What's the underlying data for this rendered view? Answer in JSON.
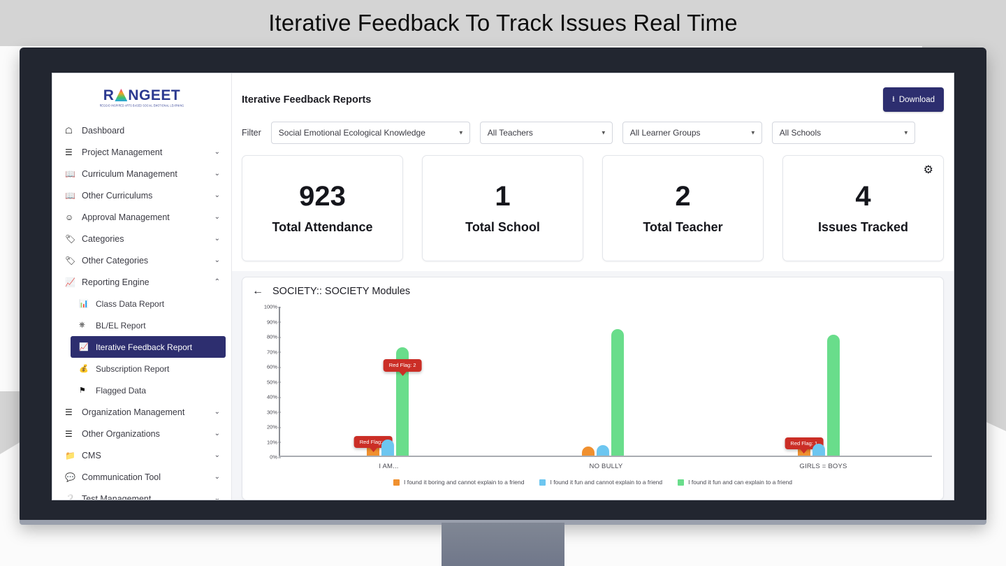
{
  "slide": {
    "title": "Iterative Feedback To Track Issues Real Time"
  },
  "brand": {
    "name": "RANGEET",
    "tagline": "REGGIO INSPIRED ARTS BASED SOCIAL EMOTIONAL LEARNING"
  },
  "sidebar": {
    "items": [
      {
        "label": "Dashboard",
        "icon": "home-icon",
        "chevron": ""
      },
      {
        "label": "Project Management",
        "icon": "server-icon",
        "chevron": "⌄"
      },
      {
        "label": "Curriculum Management",
        "icon": "book-icon",
        "chevron": "⌄"
      },
      {
        "label": "Other Curriculums",
        "icon": "book-icon",
        "chevron": "⌄"
      },
      {
        "label": "Approval Management",
        "icon": "user-check-icon",
        "chevron": "⌄"
      },
      {
        "label": "Categories",
        "icon": "tag-icon",
        "chevron": "⌄"
      },
      {
        "label": "Other Categories",
        "icon": "tag-icon",
        "chevron": "⌄"
      },
      {
        "label": "Reporting Engine",
        "icon": "chart-line-icon",
        "chevron": "⌃"
      }
    ],
    "sub_items": [
      {
        "label": "Class Data Report",
        "icon": "bar-chart-icon"
      },
      {
        "label": "BL/EL Report",
        "icon": "sitemap-icon"
      },
      {
        "label": "Iterative Feedback Report",
        "icon": "chart-area-icon"
      },
      {
        "label": "Subscription Report",
        "icon": "money-bag-icon"
      },
      {
        "label": "Flagged Data",
        "icon": "flag-icon"
      }
    ],
    "items_after": [
      {
        "label": "Organization Management",
        "icon": "server-icon",
        "chevron": "⌄"
      },
      {
        "label": "Other Organizations",
        "icon": "server-icon",
        "chevron": "⌄"
      },
      {
        "label": "CMS",
        "icon": "folder-icon",
        "chevron": "⌄"
      },
      {
        "label": "Communication Tool",
        "icon": "comment-icon",
        "chevron": "⌄"
      },
      {
        "label": "Test Management",
        "icon": "help-circle-icon",
        "chevron": "⌄"
      }
    ],
    "active_label": "Iterative Feedback Report",
    "active_color": "#2d2e6f"
  },
  "header": {
    "title": "Iterative Feedback Reports",
    "download_label": "Download",
    "download_icon": "download-icon",
    "download_color": "#2d2e6f"
  },
  "filter": {
    "label": "Filter",
    "selects": [
      {
        "name": "curriculum",
        "value": "Social Emotional Ecological Knowledge"
      },
      {
        "name": "teachers",
        "value": "All Teachers"
      },
      {
        "name": "learner-groups",
        "value": "All Learner Groups"
      },
      {
        "name": "schools",
        "value": "All Schools"
      }
    ]
  },
  "stats": [
    {
      "value": "923",
      "label": "Total Attendance"
    },
    {
      "value": "1",
      "label": "Total School"
    },
    {
      "value": "2",
      "label": "Total Teacher"
    },
    {
      "value": "4",
      "label": "Issues Tracked",
      "gear_icon": "gear-icon"
    }
  ],
  "chart_panel": {
    "back_icon": "arrow-left-icon",
    "title": "SOCIETY:: SOCIETY Modules"
  },
  "chart_data": {
    "type": "bar",
    "title": "SOCIETY:: SOCIETY Modules",
    "xlabel": "",
    "ylabel": "",
    "ylim": [
      0,
      100
    ],
    "yticks": [
      "0%",
      "10%",
      "20%",
      "30%",
      "40%",
      "50%",
      "60%",
      "70%",
      "80%",
      "90%",
      "100%"
    ],
    "grid": false,
    "legend_position": "bottom",
    "categories": [
      "I AM...",
      "NO BULLY",
      "GIRLS = BOYS"
    ],
    "series": [
      {
        "name": "I found it boring and cannot explain to a friend",
        "color": "#f0902f",
        "values": [
          13,
          6,
          9
        ]
      },
      {
        "name": "I found it fun and cannot explain to a friend",
        "color": "#6dc6f0",
        "values": [
          11,
          7,
          8
        ]
      },
      {
        "name": "I found it fun and can explain to a friend",
        "color": "#69dd8b",
        "values": [
          73,
          85,
          81
        ]
      }
    ],
    "annotations": [
      {
        "text": "Red Flag: 1",
        "category": "I AM...",
        "series": 0,
        "value": 13,
        "color": "#cb2e26"
      },
      {
        "text": "Red Flag: 2",
        "category": "I AM...",
        "series": 2,
        "value": 73,
        "color": "#cb2e26"
      },
      {
        "text": "Red Flag: 1",
        "category": "GIRLS = BOYS",
        "series": 0,
        "value": 9,
        "color": "#cb2e26"
      }
    ]
  }
}
